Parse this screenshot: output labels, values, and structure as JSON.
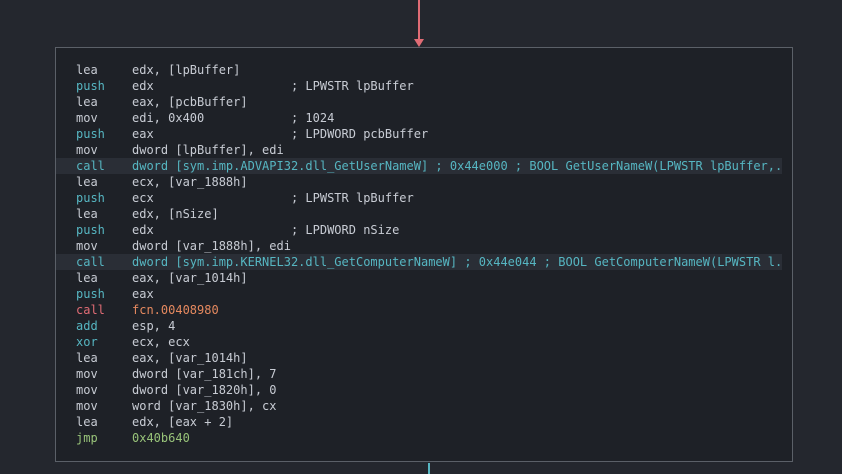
{
  "colors": {
    "background": "#24272e",
    "node_background": "#1e2127",
    "node_border": "#5b6068",
    "edge_in": "#e06c75",
    "edge_out": "#56b6c2",
    "text": "#c8ccd4",
    "mnemonic_push_call": "#56b6c2",
    "mnemonic_jmp": "#98c379",
    "function_call": "#e06c75",
    "numeric_literal": "#e5895f"
  },
  "node": {
    "lines": [
      {
        "mnemonic": "lea",
        "operands": "edx, [lpBuffer]",
        "style": "default"
      },
      {
        "mnemonic": "push",
        "operands": "edx                   ; LPWSTR lpBuffer",
        "style": "push"
      },
      {
        "mnemonic": "lea",
        "operands": "eax, [pcbBuffer]",
        "style": "default"
      },
      {
        "mnemonic": "mov",
        "operands": "edi, 0x400            ; 1024",
        "style": "default"
      },
      {
        "mnemonic": "push",
        "operands": "eax                   ; LPDWORD pcbBuffer",
        "style": "push"
      },
      {
        "mnemonic": "mov",
        "operands": "dword [lpBuffer], edi",
        "style": "default"
      },
      {
        "mnemonic": "call",
        "operands": "dword [sym.imp.ADVAPI32.dll_GetUserNameW] ; 0x44e000 ; BOOL GetUserNameW(LPWSTR lpBuffer,...",
        "style": "call-sym"
      },
      {
        "mnemonic": "lea",
        "operands": "ecx, [var_1888h]",
        "style": "default"
      },
      {
        "mnemonic": "push",
        "operands": "ecx                   ; LPWSTR lpBuffer",
        "style": "push"
      },
      {
        "mnemonic": "lea",
        "operands": "edx, [nSize]",
        "style": "default"
      },
      {
        "mnemonic": "push",
        "operands": "edx                   ; LPDWORD nSize",
        "style": "push"
      },
      {
        "mnemonic": "mov",
        "operands": "dword [var_1888h], edi",
        "style": "default"
      },
      {
        "mnemonic": "call",
        "operands": "dword [sym.imp.KERNEL32.dll_GetComputerNameW] ; 0x44e044 ; BOOL GetComputerNameW(LPWSTR l...",
        "style": "call-sym"
      },
      {
        "mnemonic": "lea",
        "operands": "eax, [var_1014h]",
        "style": "default"
      },
      {
        "mnemonic": "push",
        "operands": "eax",
        "style": "push"
      },
      {
        "mnemonic": "call",
        "operands": "fcn.00408980",
        "style": "call-fcn"
      },
      {
        "mnemonic": "add",
        "operands": "esp, 4",
        "style": "add"
      },
      {
        "mnemonic": "xor",
        "operands": "ecx, ecx",
        "style": "xor"
      },
      {
        "mnemonic": "lea",
        "operands": "eax, [var_1014h]",
        "style": "default"
      },
      {
        "mnemonic": "mov",
        "operands": "dword [var_181ch], 7",
        "style": "default"
      },
      {
        "mnemonic": "mov",
        "operands": "dword [var_1820h], 0",
        "style": "default"
      },
      {
        "mnemonic": "mov",
        "operands": "word [var_1830h], cx",
        "style": "default"
      },
      {
        "mnemonic": "lea",
        "operands": "edx, [eax + 2]",
        "style": "default"
      },
      {
        "mnemonic": "jmp",
        "operands": "0x40b640",
        "style": "jmp"
      }
    ]
  }
}
